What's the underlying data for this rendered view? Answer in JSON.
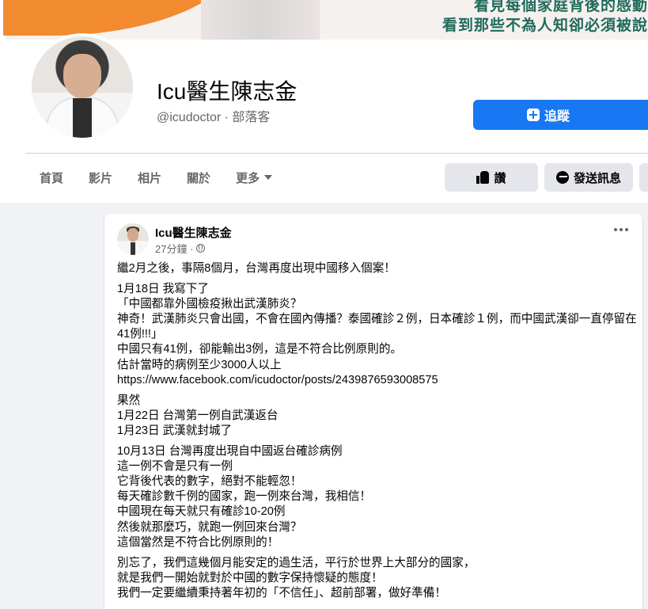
{
  "cover": {
    "line1": "看見每個家庭背後的感動",
    "line2": "看到那些不為人知卻必須被說"
  },
  "profile": {
    "name": "Icu醫生陳志金",
    "handle_and_category": "@icudoctor · 部落客",
    "follow_label": "追蹤"
  },
  "tabs": [
    {
      "label": "首頁"
    },
    {
      "label": "影片"
    },
    {
      "label": "相片"
    },
    {
      "label": "關於"
    },
    {
      "label": "更多"
    }
  ],
  "actions": {
    "like_label": "讚",
    "message_label": "發送訊息"
  },
  "post": {
    "author": "Icu醫生陳志金",
    "time": "27分鐘 ·",
    "paragraphs": [
      [
        "繼2月之後，事隔8個月，台灣再度出現中國移入個案！"
      ],
      [
        "1月18日 我寫下了",
        "「中國都靠外國檢疫揪出武漢肺炎？",
        "神奇！武漢肺炎只會出國，不會在國內傳播？泰國確診２例，日本確診１例，而中國武漢卻一直停留在41例!!!」",
        "中國只有41例，卻能輸出3例，這是不符合比例原則的。",
        "估計當時的病例至少3000人以上",
        "https://www.facebook.com/icudoctor/posts/2439876593008575"
      ],
      [
        "果然",
        "1月22日 台灣第一例自武漢返台",
        "1月23日 武漢就封城了"
      ],
      [
        "10月13日 台灣再度出現自中國返台確診病例",
        "這一例不會是只有一例",
        "它背後代表的數字，絕對不能輕忽！",
        "每天確診數千例的國家，跑一例來台灣，我相信！",
        "中國現在每天就只有確診10-20例",
        "然後就那麼巧，就跑一例回來台灣？",
        "這個當然是不符合比例原則的！"
      ],
      [
        "別忘了，我們這幾個月能安定的過生活，平行於世界上大部分的國家，",
        "就是我們一開始就對於中國的數字保持懷疑的態度！",
        "我們一定要繼續秉持著年初的「不信任」、超前部署，做好準備！"
      ]
    ]
  },
  "colors": {
    "primary": "#1877f2",
    "background": "#f0f2f5",
    "secondary_text": "#65676b",
    "button_gray": "#e4e6eb",
    "cover_accent": "#f28a30",
    "cover_text": "#1f6b5b"
  },
  "icons": [
    "plus-square-icon",
    "thumbs-up-icon",
    "messenger-icon",
    "caret-down-icon",
    "globe-icon",
    "more-dots-icon"
  ]
}
